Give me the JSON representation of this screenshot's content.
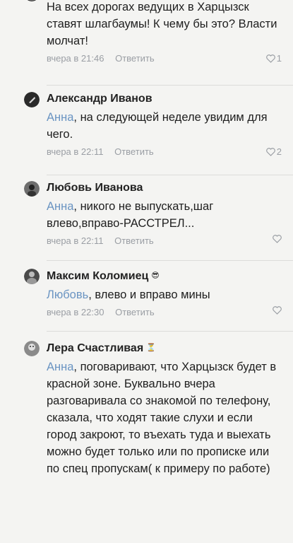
{
  "comments": [
    {
      "author": "",
      "text": "На всех дорогах ведущих в Харцызск ставят шлагбаумы! К чему бы это? Власти молчат!",
      "time": "вчера в 21:46",
      "reply_label": "Ответить",
      "likes": "1"
    },
    {
      "author": "Александр Иванов",
      "mention": "Анна",
      "text": ", на следующей неделе увидим для чего.",
      "time": "вчера в 22:11",
      "reply_label": "Ответить",
      "likes": "2"
    },
    {
      "author": "Любовь Иванова",
      "mention": "Анна",
      "text": ", никого не выпускать,шаг влево,вправо-РАССТРЕЛ...",
      "time": "вчера в 22:11",
      "reply_label": "Ответить",
      "likes": ""
    },
    {
      "author": "Максим Коломиец",
      "author_emoji": "😎",
      "mention": "Любовь",
      "text": ", влево и вправо мины",
      "time": "вчера в 22:30",
      "reply_label": "Ответить",
      "likes": ""
    },
    {
      "author": "Лера Счастливая",
      "author_emoji": "⏳",
      "mention": "Анна",
      "text": ", поговаривают, что Харцызск будет в красной зоне. Буквально вчера разговаривала со знакомой по телефону, сказала, что ходят такие слухи и если город закроют, то въехать туда и выехать можно будет только или по прописке или по спец пропускам( к примеру по работе)"
    }
  ]
}
